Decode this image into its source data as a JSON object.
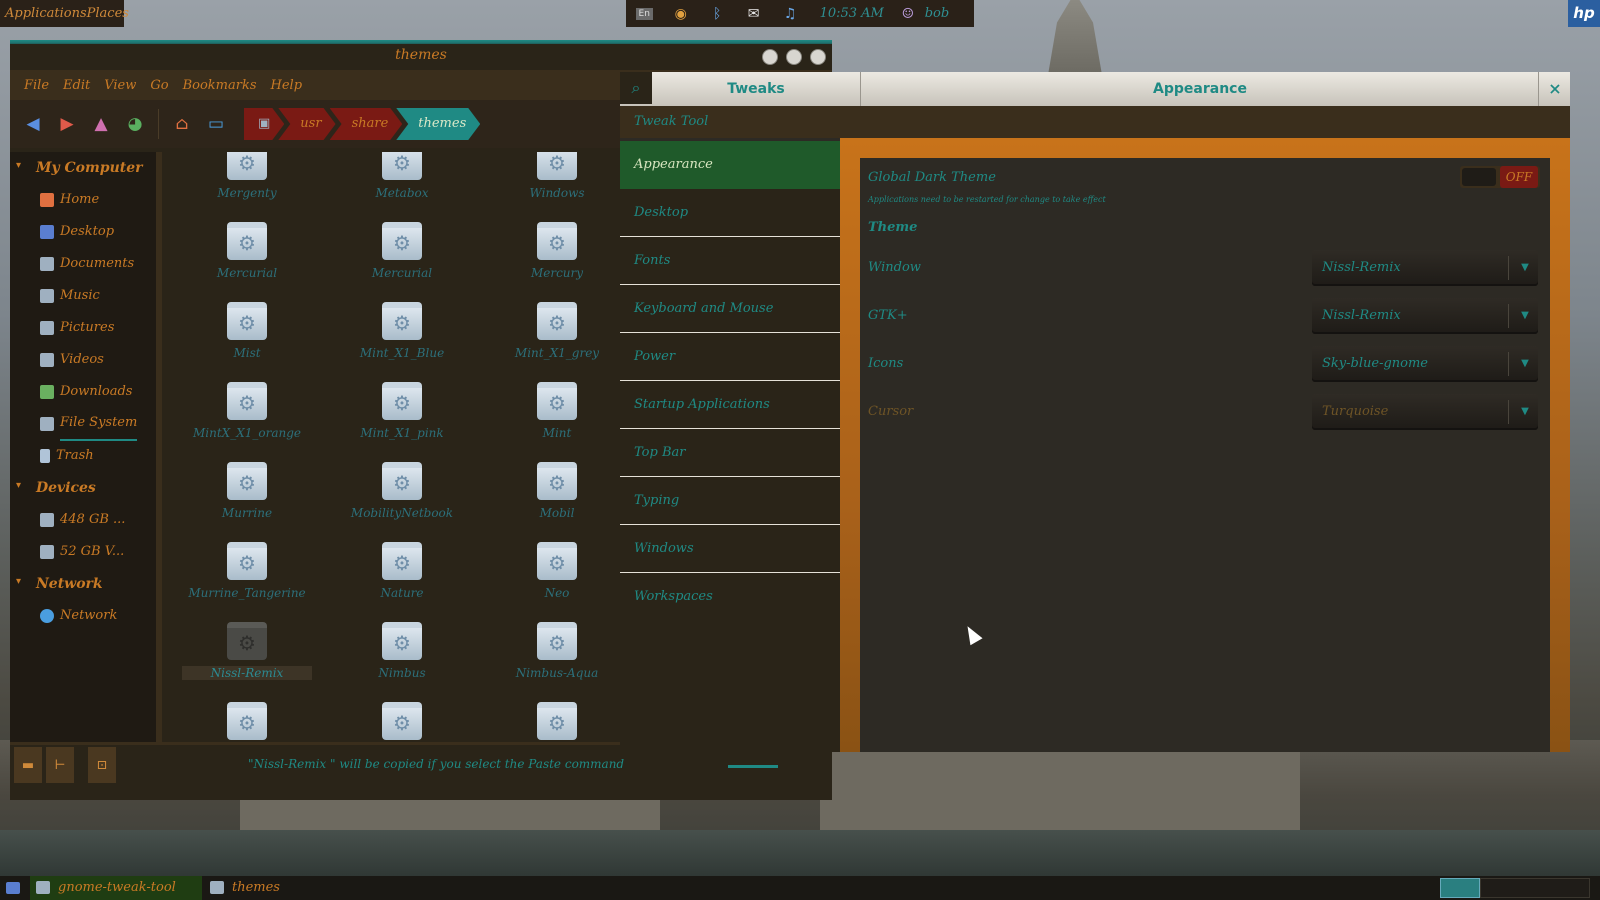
{
  "top_panel": {
    "apps_label": "ApplicationsPlaces",
    "tray_keyboard": "En",
    "clock": "10:53 AM",
    "user": "bob"
  },
  "file_manager": {
    "title": "themes",
    "menu": [
      "File",
      "Edit",
      "View",
      "Go",
      "Bookmarks",
      "Help"
    ],
    "breadcrumb": [
      "usr",
      "share",
      "themes"
    ],
    "sidebar": {
      "sections": [
        {
          "title": "My Computer",
          "items": [
            "Home",
            "Desktop",
            "Documents",
            "Music",
            "Pictures",
            "Videos",
            "Downloads",
            "File System",
            "Trash"
          ]
        },
        {
          "title": "Devices",
          "items": [
            "448 GB ...",
            "52 GB V..."
          ]
        },
        {
          "title": "Network",
          "items": [
            "Network"
          ]
        }
      ]
    },
    "folders": [
      [
        "Mergenty",
        "Metabox",
        "Windows"
      ],
      [
        "Mercurial",
        "Mercurial",
        "Mercury"
      ],
      [
        "Mist",
        "Mint_X1_Blue",
        "Mint_X1_grey"
      ],
      [
        "MintX_X1_orange",
        "Mint_X1_pink",
        "Mint"
      ],
      [
        "Murrine",
        "MobilityNetbook",
        "Mobil"
      ],
      [
        "Murrine_Tangerine",
        "Nature",
        "Neo"
      ],
      [
        "Nissl-Remix",
        "Nimbus",
        "Nimbus-Aqua"
      ],
      [
        "",
        "",
        ""
      ]
    ],
    "status_message": "\"Nissl-Remix \" will be copied if you select the Paste command"
  },
  "tweak_tool": {
    "title_left": "Tweaks",
    "title_right": "Appearance",
    "close_glyph": "×",
    "subtitle": "Tweak Tool",
    "nav": [
      "Appearance",
      "Desktop",
      "Fonts",
      "Keyboard and Mouse",
      "Power",
      "Startup Applications",
      "Top Bar",
      "Typing",
      "Windows",
      "Workspaces"
    ],
    "global_dark_label": "Global Dark Theme",
    "global_dark_hint": "Applications need to be restarted for change to take effect",
    "global_dark_state": "OFF",
    "theme_heading": "Theme",
    "rows": [
      {
        "label": "Window",
        "value": "Nissl-Remix"
      },
      {
        "label": "GTK+",
        "value": "Nissl-Remix"
      },
      {
        "label": "Icons",
        "value": "Sky-blue-gnome"
      },
      {
        "label": "Cursor",
        "value": "Turquoise"
      }
    ]
  },
  "taskbar": {
    "tasks": [
      "gnome-tweak-tool",
      "themes"
    ]
  }
}
